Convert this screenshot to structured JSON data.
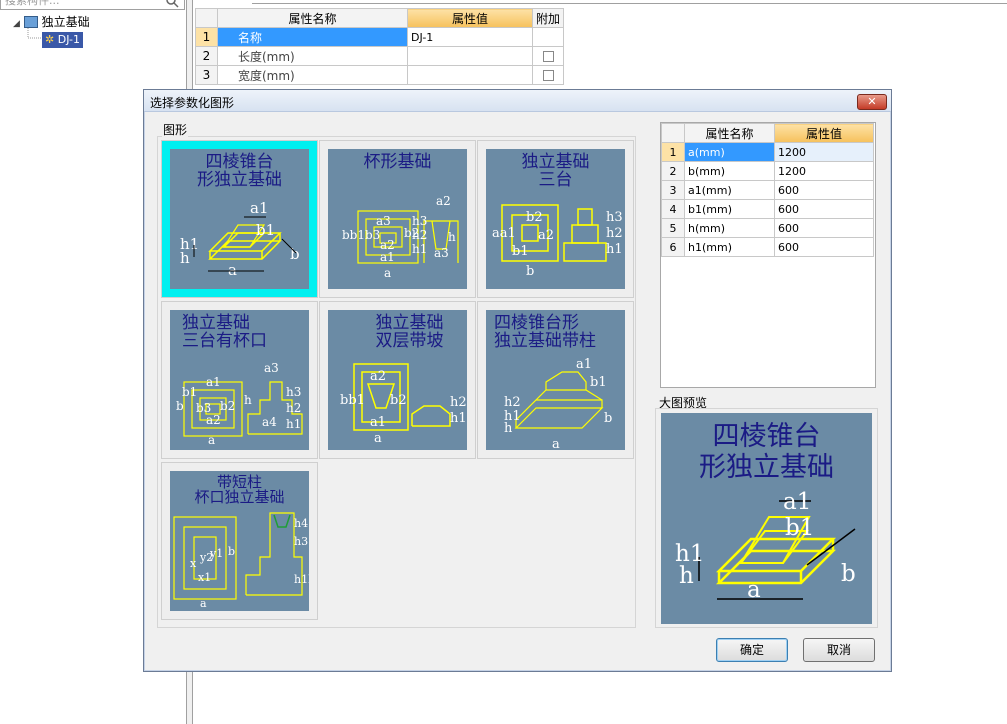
{
  "left_panel": {
    "search_placeholder": "搜索构件...",
    "tree": {
      "root_label": "独立基础",
      "child_label": "DJ-1"
    }
  },
  "property_grid": {
    "headers": [
      "属性名称",
      "属性值",
      "附加"
    ],
    "rows": [
      {
        "num": "1",
        "name": "名称",
        "value": "DJ-1"
      },
      {
        "num": "2",
        "name": "长度(mm)",
        "value": ""
      },
      {
        "num": "3",
        "name": "宽度(mm)",
        "value": ""
      }
    ]
  },
  "dialog": {
    "title": "选择参数化图形",
    "close_label": "✕",
    "shapes_group_label": "图形",
    "shapes": [
      {
        "title": "四棱锥台\n形独立基础",
        "selected": true
      },
      {
        "title": "杯形基础",
        "selected": false
      },
      {
        "title": "独立基础\n三台",
        "selected": false
      },
      {
        "title": "独立基础\n三台有杯口",
        "selected": false
      },
      {
        "title": "独立基础\n双层带坡",
        "selected": false
      },
      {
        "title": "四棱锥台形\n独立基础带柱",
        "selected": false
      },
      {
        "title": "带短柱\n杯口独立基础",
        "selected": false
      }
    ],
    "params": {
      "headers": [
        "属性名称",
        "属性值"
      ],
      "rows": [
        {
          "num": "1",
          "name": "a(mm)",
          "value": "1200"
        },
        {
          "num": "2",
          "name": "b(mm)",
          "value": "1200"
        },
        {
          "num": "3",
          "name": "a1(mm)",
          "value": "600"
        },
        {
          "num": "4",
          "name": "b1(mm)",
          "value": "600"
        },
        {
          "num": "5",
          "name": "h(mm)",
          "value": "600"
        },
        {
          "num": "6",
          "name": "h1(mm)",
          "value": "600"
        }
      ]
    },
    "preview_label": "大图预览",
    "preview_title": "四棱锥台\n形独立基础",
    "preview_dims": {
      "a1": "a1",
      "b1": "b1",
      "h1": "h1",
      "h": "h",
      "a": "a",
      "b": "b"
    },
    "ok_label": "确定",
    "cancel_label": "取消"
  },
  "colors": {
    "diagram_bg": "#6b8ba5",
    "diagram_line": "#ffff00",
    "diagram_title": "#1b1b85",
    "selection": "#00f0f0",
    "header_highlight": "#f6c15c"
  }
}
